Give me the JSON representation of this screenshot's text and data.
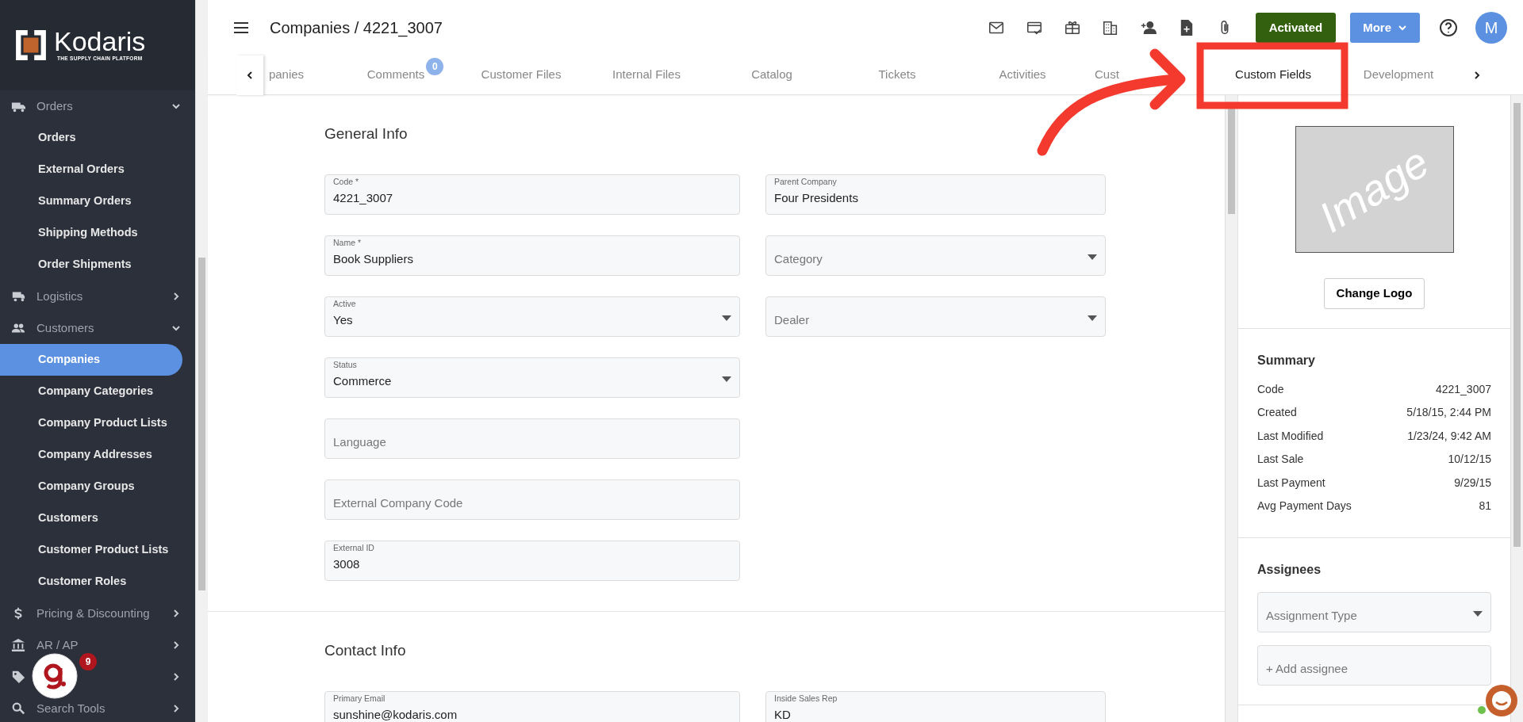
{
  "sidebar": {
    "logo": {
      "name": "Kodaris",
      "tagline": "THE SUPPLY CHAIN PLATFORM"
    },
    "groups": [
      {
        "label": "Orders",
        "expanded": true,
        "children": [
          {
            "label": "Orders",
            "selected": false
          },
          {
            "label": "External Orders",
            "selected": false
          },
          {
            "label": "Summary Orders",
            "selected": false
          },
          {
            "label": "Shipping Methods",
            "selected": false
          },
          {
            "label": "Order Shipments",
            "selected": false
          }
        ]
      },
      {
        "label": "Logistics",
        "expanded": false
      },
      {
        "label": "Customers",
        "expanded": true,
        "children": [
          {
            "label": "Companies",
            "selected": true
          },
          {
            "label": "Company Categories",
            "selected": false
          },
          {
            "label": "Company Product Lists",
            "selected": false
          },
          {
            "label": "Company Addresses",
            "selected": false
          },
          {
            "label": "Company Groups",
            "selected": false
          },
          {
            "label": "Customers",
            "selected": false
          },
          {
            "label": "Customer Product Lists",
            "selected": false
          },
          {
            "label": "Customer Roles",
            "selected": false
          }
        ]
      },
      {
        "label": "Pricing & Discounting",
        "expanded": false
      },
      {
        "label": "AR / AP",
        "expanded": false
      },
      {
        "expanded": false
      },
      {
        "label": "Search Tools",
        "expanded": false
      }
    ],
    "help_badge": {
      "count": "9"
    }
  },
  "header": {
    "title": "Companies / 4221_3007",
    "status_button": "Activated",
    "more_button": "More",
    "avatar": "M"
  },
  "tabs": [
    {
      "label": "panies",
      "selected": false
    },
    {
      "label": "Comments",
      "badge": "0",
      "selected": false
    },
    {
      "label": "Customer Files",
      "selected": false
    },
    {
      "label": "Internal Files",
      "selected": false
    },
    {
      "label": "Catalog",
      "selected": false
    },
    {
      "label": "Tickets",
      "selected": false
    },
    {
      "label": "Activities",
      "selected": false
    },
    {
      "label": "Cust",
      "selected": false
    },
    {
      "label": "Custom Fields",
      "selected": true
    },
    {
      "label": "Development",
      "selected": false
    }
  ],
  "sections": [
    {
      "title": "General Info",
      "left": [
        {
          "kind": "text",
          "label": "Code *",
          "value": "4221_3007"
        },
        {
          "kind": "text",
          "label": "Name *",
          "value": "Book Suppliers"
        },
        {
          "kind": "select",
          "label": "Active",
          "value": "Yes"
        },
        {
          "kind": "select",
          "label": "Status",
          "value": "Commerce"
        },
        {
          "kind": "text",
          "placeholder": "Language"
        },
        {
          "kind": "text",
          "placeholder": "External Company Code"
        },
        {
          "kind": "text",
          "label": "External ID",
          "value": "3008"
        }
      ],
      "right": [
        {
          "kind": "text",
          "label": "Parent Company",
          "value": "Four Presidents"
        },
        {
          "kind": "select",
          "placeholder": "Category"
        },
        {
          "kind": "select",
          "placeholder": "Dealer"
        }
      ]
    },
    {
      "title": "Contact Info",
      "left": [
        {
          "kind": "text",
          "label": "Primary Email",
          "value": "sunshine@kodaris.com"
        }
      ],
      "right": [
        {
          "kind": "text",
          "label": "Inside Sales Rep",
          "value": "KD"
        }
      ]
    }
  ],
  "side_panel": {
    "logo_placeholder": "Image",
    "change_logo_button": "Change Logo",
    "summary": {
      "title": "Summary",
      "rows": [
        {
          "label": "Code",
          "value": "4221_3007"
        },
        {
          "label": "Created",
          "value": "5/18/15, 2:44 PM"
        },
        {
          "label": "Last Modified",
          "value": "1/23/24, 9:42 AM"
        },
        {
          "label": "Last Sale",
          "value": "10/12/15"
        },
        {
          "label": "Last Payment",
          "value": "9/29/15"
        },
        {
          "label": "Avg Payment Days",
          "value": "81"
        }
      ]
    },
    "assignees": {
      "title": "Assignees",
      "fields": [
        {
          "kind": "select",
          "placeholder": "Assignment Type"
        },
        {
          "kind": "text",
          "placeholder": "+ Add assignee"
        }
      ]
    }
  }
}
